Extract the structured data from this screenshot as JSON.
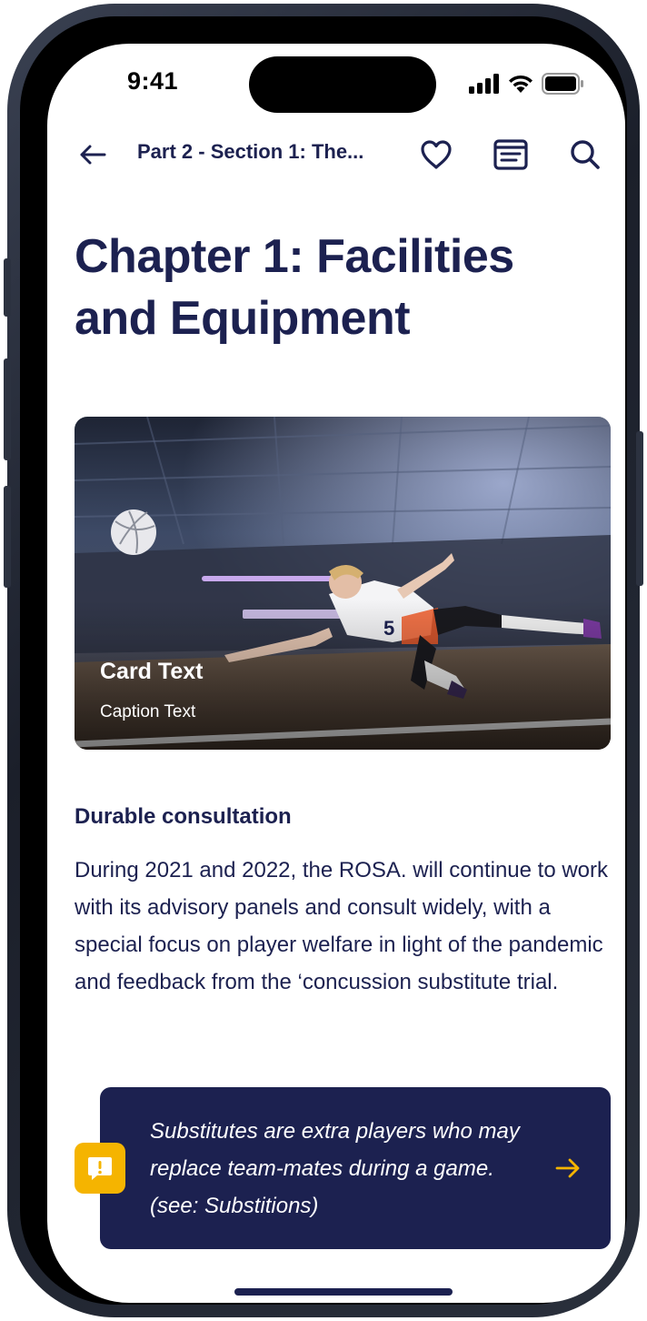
{
  "status_bar": {
    "time": "9:41",
    "icons": [
      "cellular-signal-icon",
      "wifi-icon",
      "battery-icon"
    ]
  },
  "nav": {
    "back_icon": "arrow-left-icon",
    "title": "Part 2 - Section 1: The...",
    "favorite_icon": "heart-icon",
    "toc_icon": "list-icon",
    "search_icon": "search-icon"
  },
  "chapter": {
    "title_line1": "Chapter 1: Facilities",
    "title_line2": "and Equipment"
  },
  "card": {
    "title": "Card Text",
    "caption": "Caption Text"
  },
  "section": {
    "heading": "Durable consultation",
    "body": "During 2021 and 2022, the ROSA. will continue to work with its advisory panels and consult widely, with a special focus on player welfare in light of the pandemic and feedback from the ‘concussion substitute trial."
  },
  "callout": {
    "text": "Substitutes are extra players who may replace team-mates during a game. (see: Substitions)",
    "icon": "exclamation-bubble-icon",
    "arrow_icon": "arrow-right-icon"
  },
  "colors": {
    "primary": "#1c2150",
    "accent": "#f5b400",
    "background": "#ffffff"
  }
}
